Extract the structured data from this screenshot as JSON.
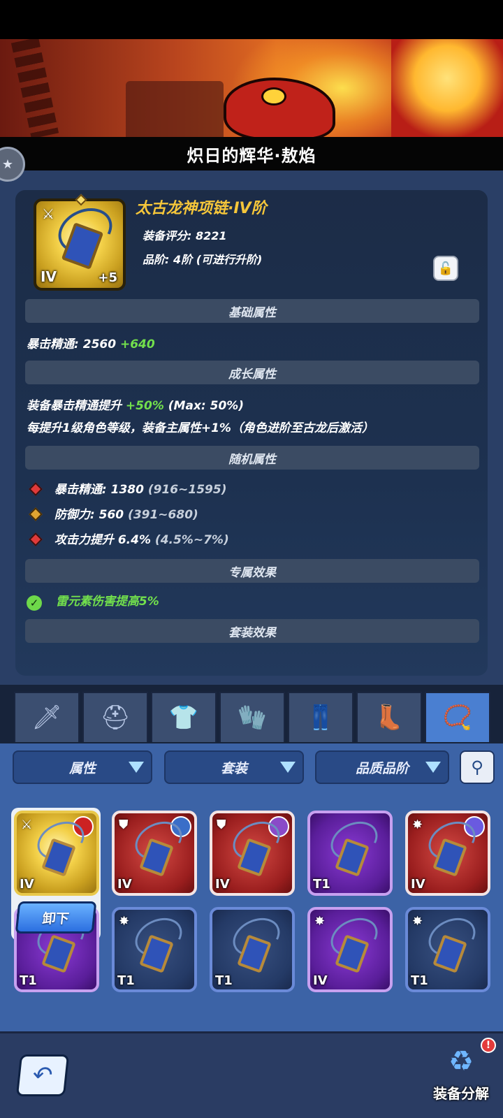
{
  "banner": {
    "title": "炽日的辉华·敖焰"
  },
  "item": {
    "name": "太古龙神项链·IV阶",
    "tier": "IV",
    "plus": "+5",
    "score_label": "装备评分:",
    "score_value": "8221",
    "grade_label": "品阶:",
    "grade_value": "4阶",
    "grade_note": "(可进行升阶)"
  },
  "sections": {
    "base": {
      "title": "基础属性",
      "line": {
        "label": "暴击精通:",
        "value": "2560",
        "bonus": "+640"
      }
    },
    "growth": {
      "title": "成长属性",
      "line1": {
        "prefix": "装备暴击精通提升",
        "bonus": "+50%",
        "suffix": "(Max: 50%)"
      },
      "line2": "每提升1级角色等级，装备主属性+1%（角色进阶至古龙后激活）"
    },
    "random": {
      "title": "随机属性",
      "stats": [
        {
          "label": "暴击精通: 1380",
          "range": "(916~1595)",
          "color": "red"
        },
        {
          "label": "防御力: 560",
          "range": "(391~680)",
          "color": "gold"
        },
        {
          "label": "攻击力提升 6.4%",
          "range": "(4.5%~7%)",
          "color": "red"
        }
      ]
    },
    "exclusive": {
      "title": "专属效果",
      "effect": "雷元素伤害提高5%"
    },
    "set": {
      "title": "套装效果"
    }
  },
  "tabs": [
    {
      "name": "weapon",
      "glyph": "🗡"
    },
    {
      "name": "helmet",
      "glyph": "⛑"
    },
    {
      "name": "armor",
      "glyph": "👕"
    },
    {
      "name": "bracer",
      "glyph": "🧤"
    },
    {
      "name": "pants",
      "glyph": "👖"
    },
    {
      "name": "boots",
      "glyph": "👢"
    },
    {
      "name": "necklace",
      "glyph": "📿"
    }
  ],
  "filters": {
    "attr": "属性",
    "set": "套装",
    "quality": "品质品阶"
  },
  "inventory": {
    "unequip_label": "卸下",
    "cards": [
      {
        "rarity": "gold",
        "tier": "IV"
      },
      {
        "rarity": "red",
        "tier": "IV"
      },
      {
        "rarity": "red",
        "tier": "IV"
      },
      {
        "rarity": "purple",
        "tier": "T1"
      },
      {
        "rarity": "red",
        "tier": "IV"
      },
      {
        "rarity": "purple",
        "tier": "T1"
      },
      {
        "rarity": "blue",
        "tier": "T1"
      },
      {
        "rarity": "blue",
        "tier": "T1"
      },
      {
        "rarity": "purple",
        "tier": "IV"
      },
      {
        "rarity": "blue",
        "tier": "T1"
      }
    ]
  },
  "bottom": {
    "decompose_label": "装备分解",
    "alert": "!"
  }
}
